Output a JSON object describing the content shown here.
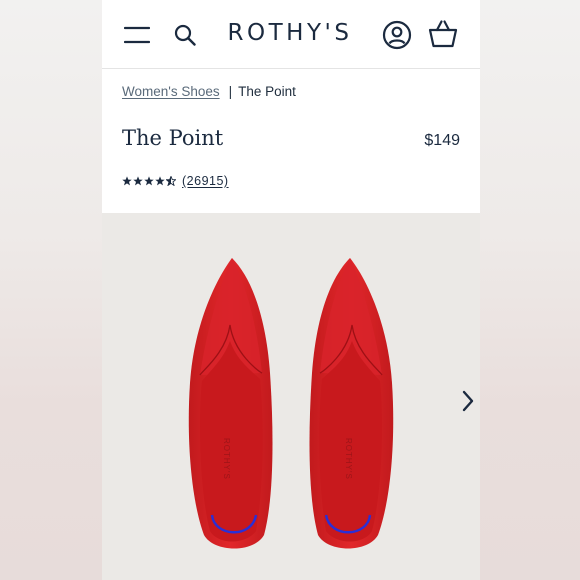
{
  "header": {
    "logo": "ROTHY'S",
    "icons": [
      "menu-icon",
      "search-icon",
      "account-icon",
      "cart-icon"
    ]
  },
  "breadcrumb": {
    "parent": "Women's Shoes",
    "separator": "|",
    "current": "The Point"
  },
  "product": {
    "title": "The Point",
    "price": "$149",
    "rating": 4.5,
    "review_count": "(26915)",
    "color": "#d21f22",
    "insole_text": "ROTHY'S",
    "gallery_next_icon": "chevron-right-icon"
  },
  "colors": {
    "navy": "#1b2a3f",
    "shoe_red": "#d21f22",
    "accent_blue": "#2a2fd6",
    "image_bg": "#ebe9e6"
  }
}
